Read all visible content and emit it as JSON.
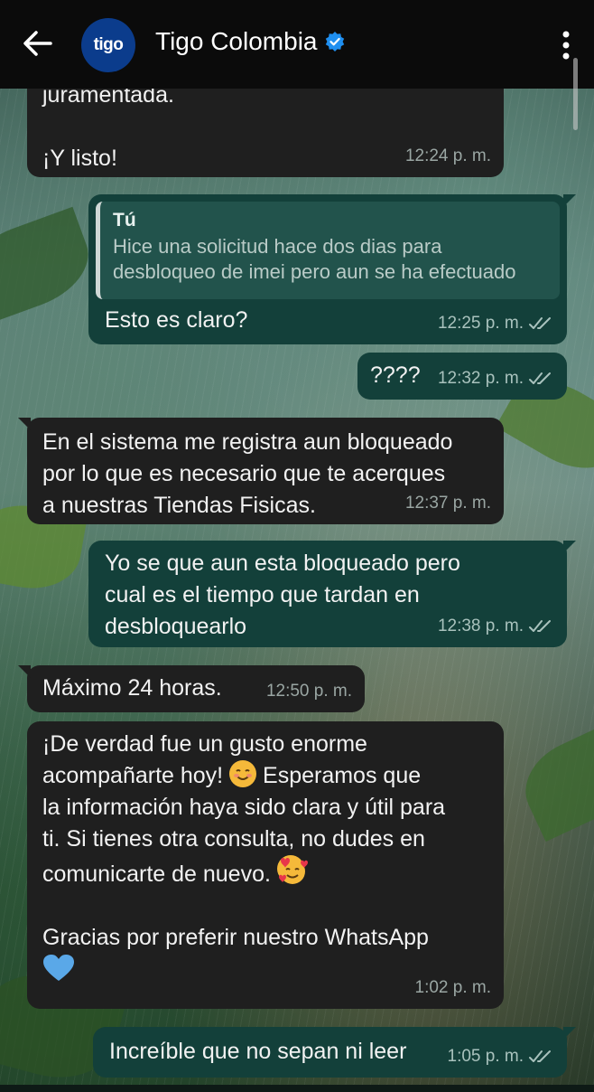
{
  "header": {
    "title": "Tigo Colombia",
    "avatar_text": "tigo",
    "verified_icon": "verified-badge-icon",
    "back_icon": "back-arrow-icon",
    "menu_icon": "more-vertical-icon"
  },
  "colors": {
    "header_bg": "#0b0b0b",
    "incoming_bubble": "#1f1f1f",
    "outgoing_bubble": "#13403a",
    "avatar_bg": "#0b3c8c",
    "verified": "#1f8ff0",
    "read_ticks": "#a9c2bd"
  },
  "messages": [
    {
      "dir": "in",
      "text": "juramentada.\n\n¡Y listo!",
      "time": "12:24 p. m."
    },
    {
      "dir": "out",
      "quote_author": "Tú",
      "quote_text": "Hice una solicitud hace dos dias para\ndesbloqueo de imei pero aun se ha efectuado",
      "text": "Esto es claro?",
      "time": "12:25 p. m.",
      "status": "read-ticks-icon"
    },
    {
      "dir": "out",
      "text": "????",
      "time": "12:32 p. m.",
      "status": "read-ticks-icon"
    },
    {
      "dir": "in",
      "text": "En el sistema me registra aun bloqueado\npor lo que es necesario que te acerques\na nuestras Tiendas Fisicas.",
      "time": "12:37 p. m."
    },
    {
      "dir": "out",
      "text": "Yo se que aun esta bloqueado pero\ncual es el tiempo que tardan en\ndesbloquearlo",
      "time": "12:38 p. m.",
      "status": "read-ticks-icon"
    },
    {
      "dir": "in",
      "text": "Máximo 24 horas.",
      "time": "12:50 p. m."
    },
    {
      "dir": "in",
      "text_a": "¡De verdad fue un gusto enorme\nacompañarte hoy! ",
      "text_b": " Esperamos que\nla información haya sido clara y útil para\nti. Si tienes otra consulta, no dudes en\ncomunicarte de nuevo. ",
      "text_c": "\n\nGracias por preferir nuestro WhatsApp\n",
      "emoji_1": "smiling-face-emoji",
      "emoji_2": "smiling-face-with-hearts-emoji",
      "emoji_3": "blue-heart-emoji",
      "time": "1:02 p. m."
    },
    {
      "dir": "out",
      "text": "Increíble que no sepan ni leer",
      "time": "1:05 p. m.",
      "status": "read-ticks-icon"
    }
  ]
}
